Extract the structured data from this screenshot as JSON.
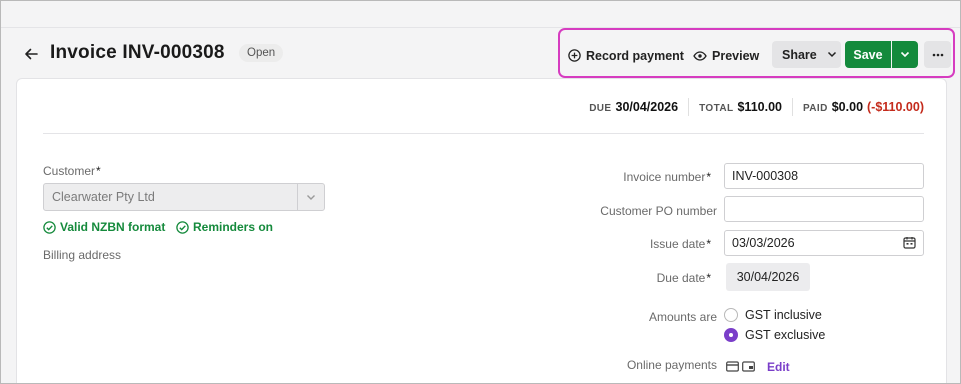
{
  "header": {
    "title": "Invoice INV-000308",
    "status": "Open"
  },
  "actions": {
    "record_payment": "Record payment",
    "preview": "Preview",
    "share": "Share",
    "save": "Save"
  },
  "summary": {
    "due_label": "DUE",
    "due_value": "30/04/2026",
    "total_label": "TOTAL",
    "total_value": "$110.00",
    "paid_label": "PAID",
    "paid_value": "$0.00",
    "paid_balance": "(-$110.00)"
  },
  "customer": {
    "label": "Customer",
    "value": "Clearwater Pty Ltd",
    "nzbn": "Valid NZBN format",
    "reminders": "Reminders on",
    "billing_label": "Billing address"
  },
  "fields": {
    "invoice_number_label": "Invoice number",
    "invoice_number": "INV-000308",
    "po_label": "Customer PO number",
    "po_value": "",
    "issue_date_label": "Issue date",
    "issue_date": "03/03/2026",
    "due_date_label": "Due date",
    "due_date": "30/04/2026",
    "amounts_label": "Amounts are",
    "gst_inclusive": "GST inclusive",
    "gst_exclusive": "GST exclusive",
    "online_payments_label": "Online payments",
    "edit": "Edit"
  },
  "colors": {
    "accent_green": "#148a3c",
    "accent_purple": "#7a3ec9",
    "highlight_border": "#d63cc0",
    "negative": "#c42b1c"
  }
}
